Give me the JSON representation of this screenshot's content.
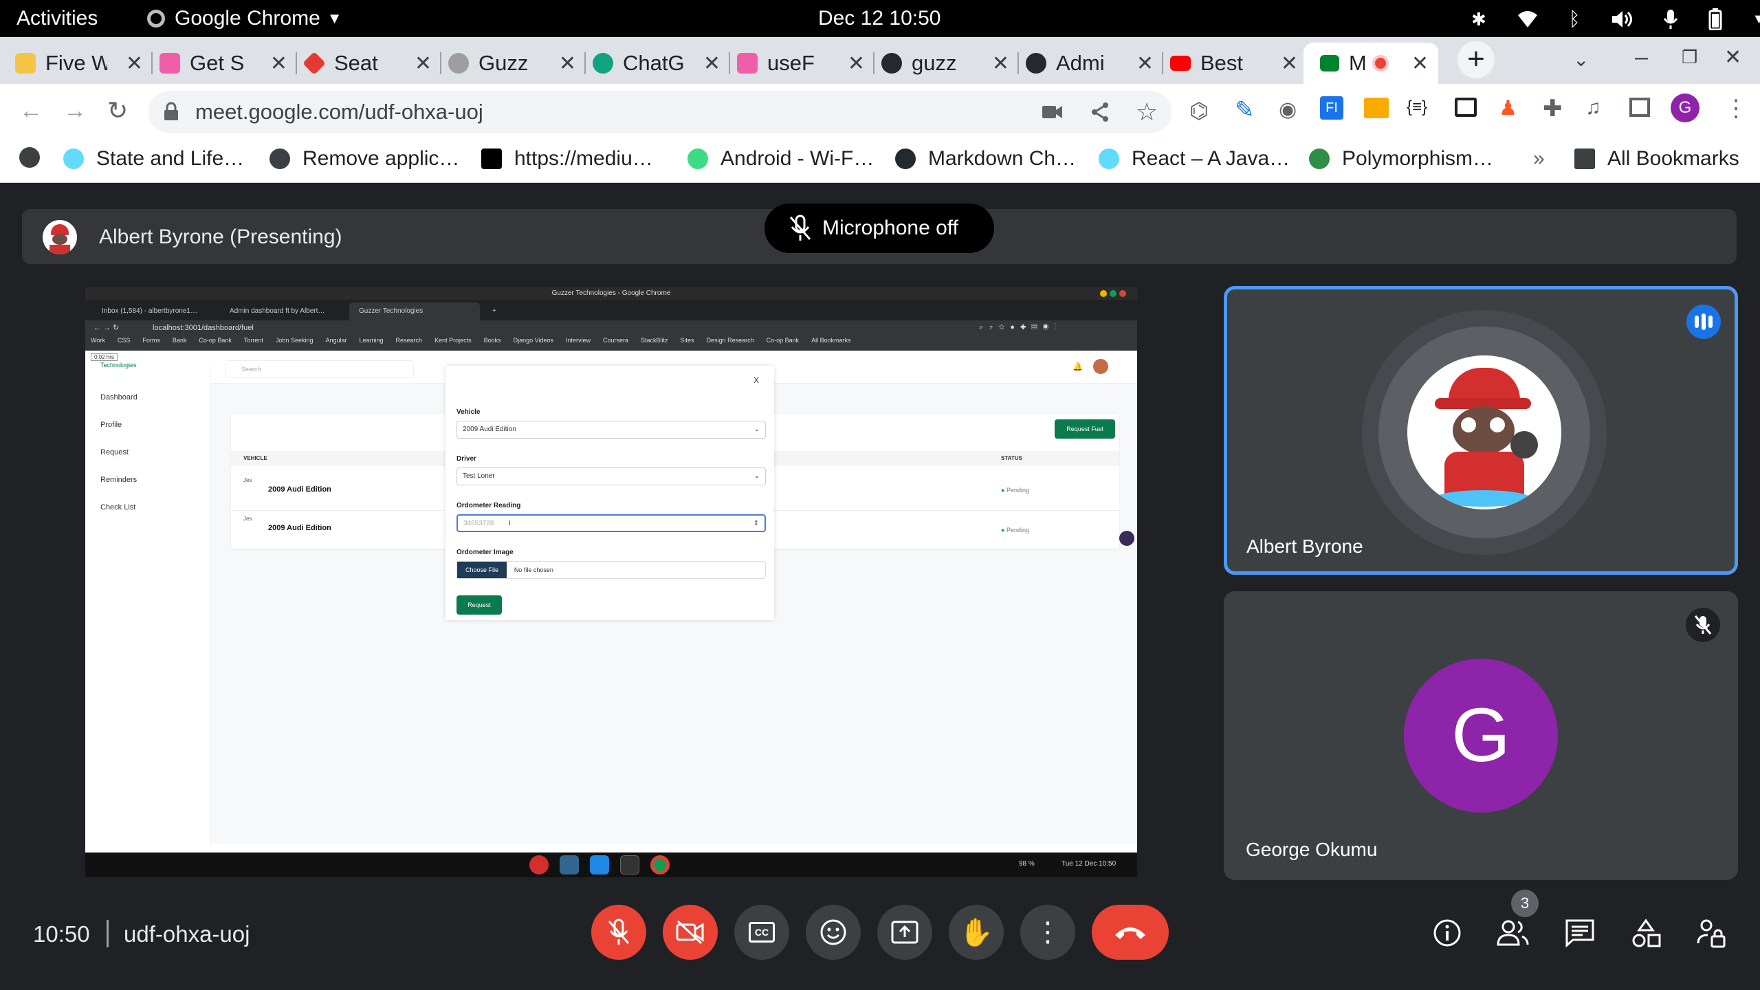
{
  "system": {
    "activities": "Activities",
    "app_name": "Google Chrome",
    "clock": "Dec 12  10:50"
  },
  "tabs": [
    {
      "title": "Five W",
      "color": "#f6c445"
    },
    {
      "title": "Get S",
      "color": "#ef5fa7"
    },
    {
      "title": "Seat",
      "color": "#e53935"
    },
    {
      "title": "Guzz",
      "color": "#9e9e9e"
    },
    {
      "title": "ChatG",
      "color": "#10a37f"
    },
    {
      "title": "useF",
      "color": "#ef5fa7"
    },
    {
      "title": "guzz",
      "color": "#24292f"
    },
    {
      "title": "Admi",
      "color": "#24292f"
    },
    {
      "title": "Best",
      "color": "#ff0000"
    },
    {
      "title": "M",
      "color": "#00832d"
    }
  ],
  "address_bar": {
    "url": "meet.google.com/udf-ohxa-uoj"
  },
  "bookmarks": [
    {
      "label": "State and Life…",
      "color": "#61dafb"
    },
    {
      "label": "Remove applic…",
      "color": "#3c4043"
    },
    {
      "label": "https://mediu…",
      "color": "#000000"
    },
    {
      "label": "Android - Wi-F…",
      "color": "#3ddc84"
    },
    {
      "label": "Markdown Ch…",
      "color": "#24292f"
    },
    {
      "label": "React – A Java…",
      "color": "#61dafb"
    },
    {
      "label": "Polymorphism…",
      "color": "#2f8d46"
    }
  ],
  "bookmarks_more": "»",
  "all_bookmarks": "All Bookmarks",
  "meet": {
    "presenter_label": "Albert Byrone (Presenting)",
    "mic_toast": "Microphone off",
    "participants": [
      {
        "name": "Albert Byrone",
        "avatar": "cartoon"
      },
      {
        "name": "George Okumu",
        "initial": "G",
        "avatar_color": "#8e24aa"
      }
    ],
    "time": "10:50",
    "meeting_code": "udf-ohxa-uoj",
    "people_count": "3"
  },
  "shared": {
    "window_title": "Guzzer Technologies - Google Chrome",
    "tabs": [
      "Inbox (1,584) - albertbyrone1…",
      "Admin dashboard ft by Albert…",
      "Guzzer Technologies"
    ],
    "url": "localhost:3001/dashboard/fuel",
    "bookmarks": [
      "Work",
      "CSS",
      "Forms",
      "Bank",
      "Co-op Bank",
      "Torrent",
      "Jobn Seeking",
      "Angular",
      "Learning",
      "Research",
      "Kent Projects",
      "Books",
      "Django Videos",
      "Interview",
      "Coursera",
      "StackBlitz",
      "Sites",
      "Design Research",
      "Co-op Bank",
      "All Bookmarks"
    ],
    "logo_badge": "0:02 hrs",
    "logo_text": "Technologies",
    "search_placeholder": "Search",
    "sidebar": [
      "Dashboard",
      "Profile",
      "Request",
      "Reminders",
      "Check List"
    ],
    "request_fuel": "Request Fuel",
    "col_vehicle": "VEHICLE",
    "col_status": "STATUS",
    "rows": [
      {
        "vehicle": "2009 Audi Edition",
        "img": "Jes",
        "status": "Pending"
      },
      {
        "vehicle": "2009 Audi Edition",
        "img": "Jes",
        "status": "Pending"
      }
    ],
    "modal": {
      "close": "X",
      "vehicle_label": "Vehicle",
      "vehicle_value": "2009 Audi Edition",
      "driver_label": "Driver",
      "driver_value": "Test Loner",
      "odometer_label": "Ordometer Reading",
      "odometer_placeholder": "34653728",
      "image_label": "Ordometer Image",
      "choose_file": "Choose File",
      "no_file": "No file chosen",
      "submit": "Request"
    },
    "taskbar_status": "98 %",
    "taskbar_clock": "Tue 12 Dec  10:50"
  }
}
